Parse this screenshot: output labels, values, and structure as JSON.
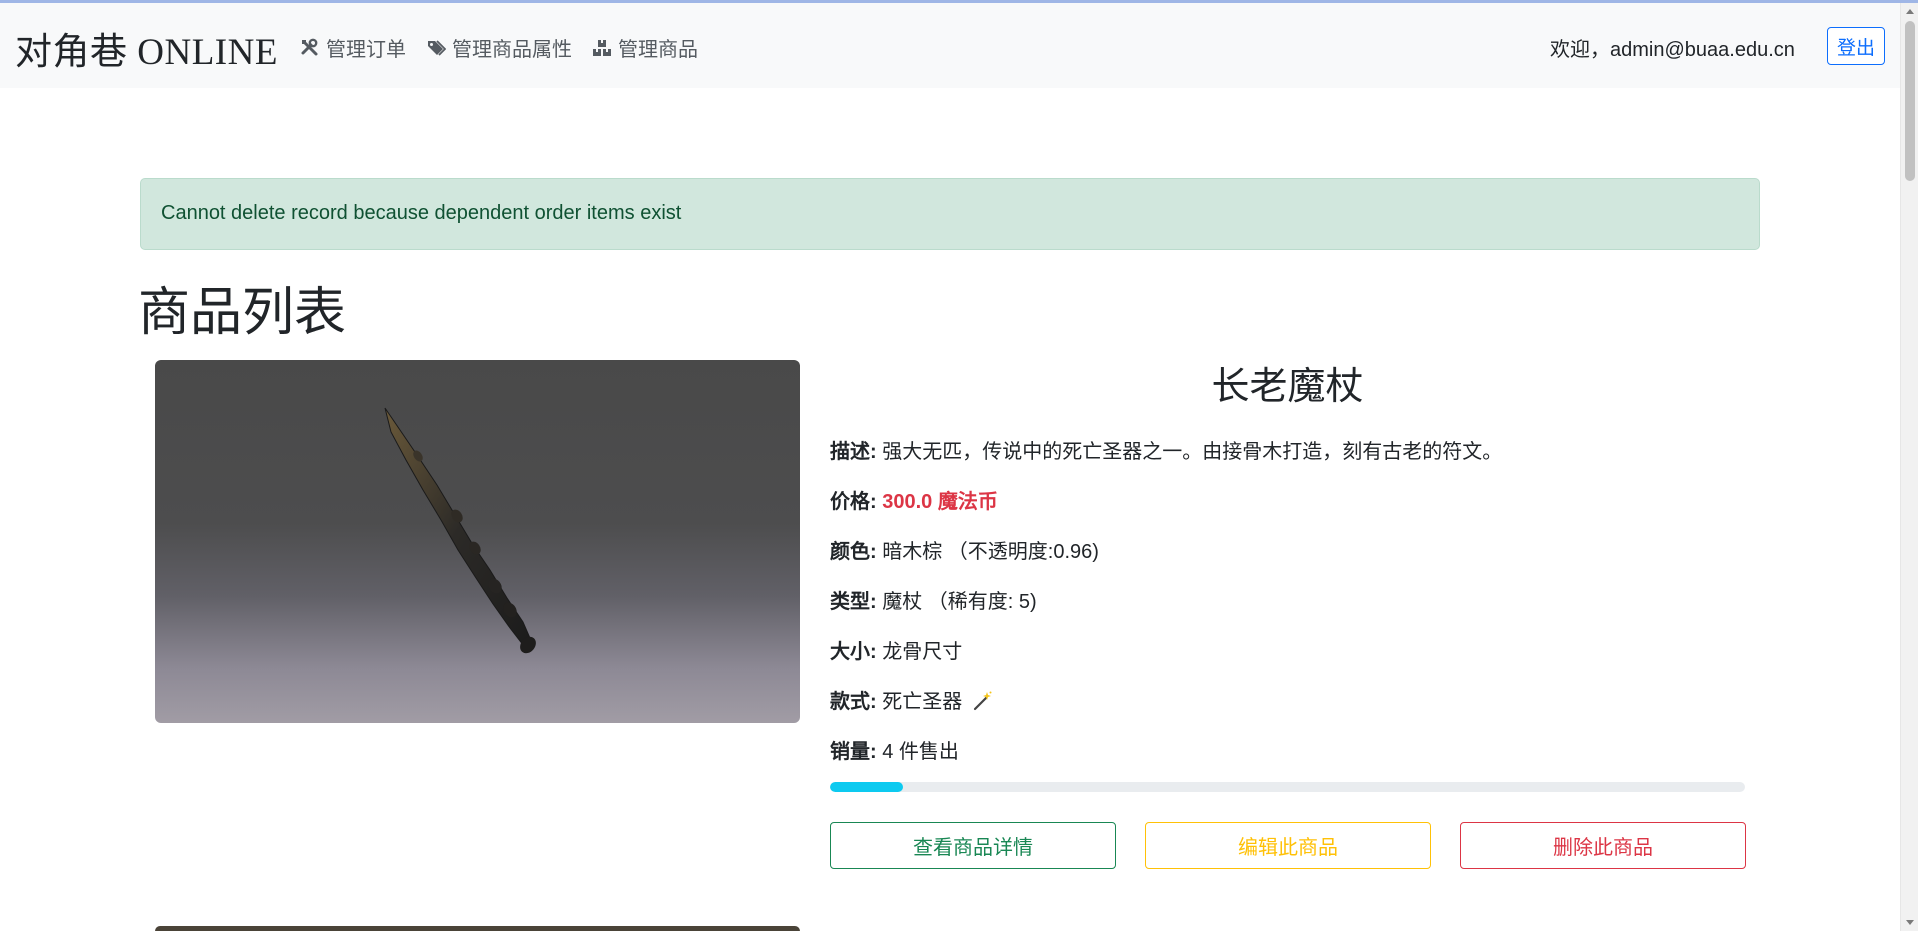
{
  "navbar": {
    "brand": "对角巷 ONLINE",
    "items": [
      {
        "label": "管理订单",
        "icon": "tools-icon"
      },
      {
        "label": "管理商品属性",
        "icon": "tags-icon"
      },
      {
        "label": "管理商品",
        "icon": "boxes-icon"
      }
    ],
    "welcome": "欢迎，admin@buaa.edu.cn",
    "logout_label": "登出"
  },
  "alert": {
    "message": "Cannot delete record because dependent order items exist"
  },
  "page": {
    "title": "商品列表"
  },
  "product": {
    "name": "长老魔杖",
    "image": "elder-wand-image",
    "description_label": "描述:",
    "description": "强大无匹，传说中的死亡圣器之一。由接骨木打造，刻有古老的符文。",
    "price_label": "价格:",
    "price": "300.0 魔法币",
    "color_label": "颜色:",
    "color": "暗木棕 （不透明度:0.96)",
    "type_label": "类型:",
    "type": "魔杖 （稀有度: 5)",
    "size_label": "大小:",
    "size": "龙骨尺寸",
    "style_label": "款式:",
    "style": "死亡圣器",
    "style_icon": "magic-wand-icon",
    "sales_label": "销量:",
    "sales": "4 件售出",
    "sales_progress_fraction": 0.08,
    "actions": {
      "view_label": "查看商品详情",
      "edit_label": "编辑此商品",
      "delete_label": "删除此商品"
    }
  },
  "colors": {
    "price": "#dc3545",
    "alert_bg": "#d1e7dd",
    "progress": "#0dcaf0",
    "view": "#198754",
    "edit": "#ffc107",
    "delete": "#dc3545",
    "logout": "#0d6efd"
  }
}
